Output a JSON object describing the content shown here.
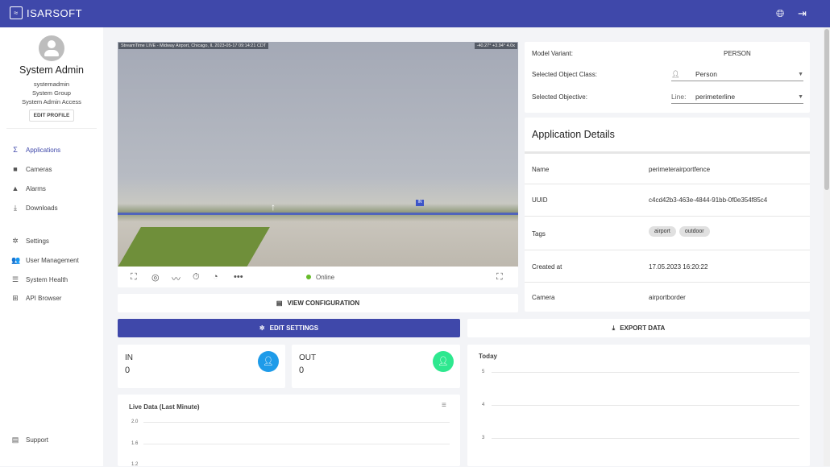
{
  "header": {
    "brand": "ISARSOFT",
    "globe_icon": "globe-icon",
    "logout_icon": "logout-icon"
  },
  "profile": {
    "name": "System Admin",
    "username": "systemadmin",
    "group": "System Group",
    "access": "System Admin Access",
    "edit_label": "EDIT PROFILE"
  },
  "nav": [
    {
      "label": "Applications",
      "icon": "Σ"
    },
    {
      "label": "Cameras",
      "icon": "■"
    },
    {
      "label": "Alarms",
      "icon": "▲"
    },
    {
      "label": "Downloads",
      "icon": "⤓"
    },
    {
      "label": "Settings",
      "icon": "✲"
    },
    {
      "label": "User Management",
      "icon": "👥"
    },
    {
      "label": "System Health",
      "icon": "☰"
    },
    {
      "label": "API Browser",
      "icon": "⊞"
    }
  ],
  "support": "Support",
  "video": {
    "overlay_left": "StreamTime LIVE - Midway Airport, Chicago, IL  2023-05-17  09:14:21 CDT",
    "overlay_right": "-40.27°  +3.94°  4.0x",
    "line_label_in": "IN",
    "status": "Online",
    "status_color": "#66bb2a"
  },
  "view_config": "VIEW CONFIGURATION",
  "model": {
    "variant_label": "Model Variant:",
    "variant": "PERSON",
    "class_label": "Selected Object Class:",
    "class_value": "Person",
    "objective_label": "Selected Objective:",
    "objective_prefix": "Line:",
    "objective_value": "perimeterline"
  },
  "details": {
    "title": "Application Details",
    "rows": [
      {
        "k": "Name",
        "v": "perimeterairportfence"
      },
      {
        "k": "UUID",
        "v": "c4cd42b3-463e-4844-91bb-0f0e354f85c4"
      },
      {
        "k": "Tags",
        "tags": [
          "airport",
          "outdoor"
        ]
      },
      {
        "k": "Created at",
        "v": "17.05.2023 16:20:22"
      },
      {
        "k": "Camera",
        "v": "airportborder"
      }
    ]
  },
  "edit_settings": "EDIT SETTINGS",
  "export_data": "EXPORT DATA",
  "counters": {
    "in_label": "IN",
    "in_value": "0",
    "out_label": "OUT",
    "out_value": "0",
    "in_color": "#1e9be9",
    "out_color": "#2ee88f"
  },
  "live": {
    "title": "Live Data (Last Minute)",
    "ticks": [
      "2.0",
      "1.6",
      "1.2"
    ]
  },
  "today": {
    "title": "Today",
    "ticks": [
      "5",
      "4",
      "3"
    ]
  },
  "accent": "#3f48aa"
}
